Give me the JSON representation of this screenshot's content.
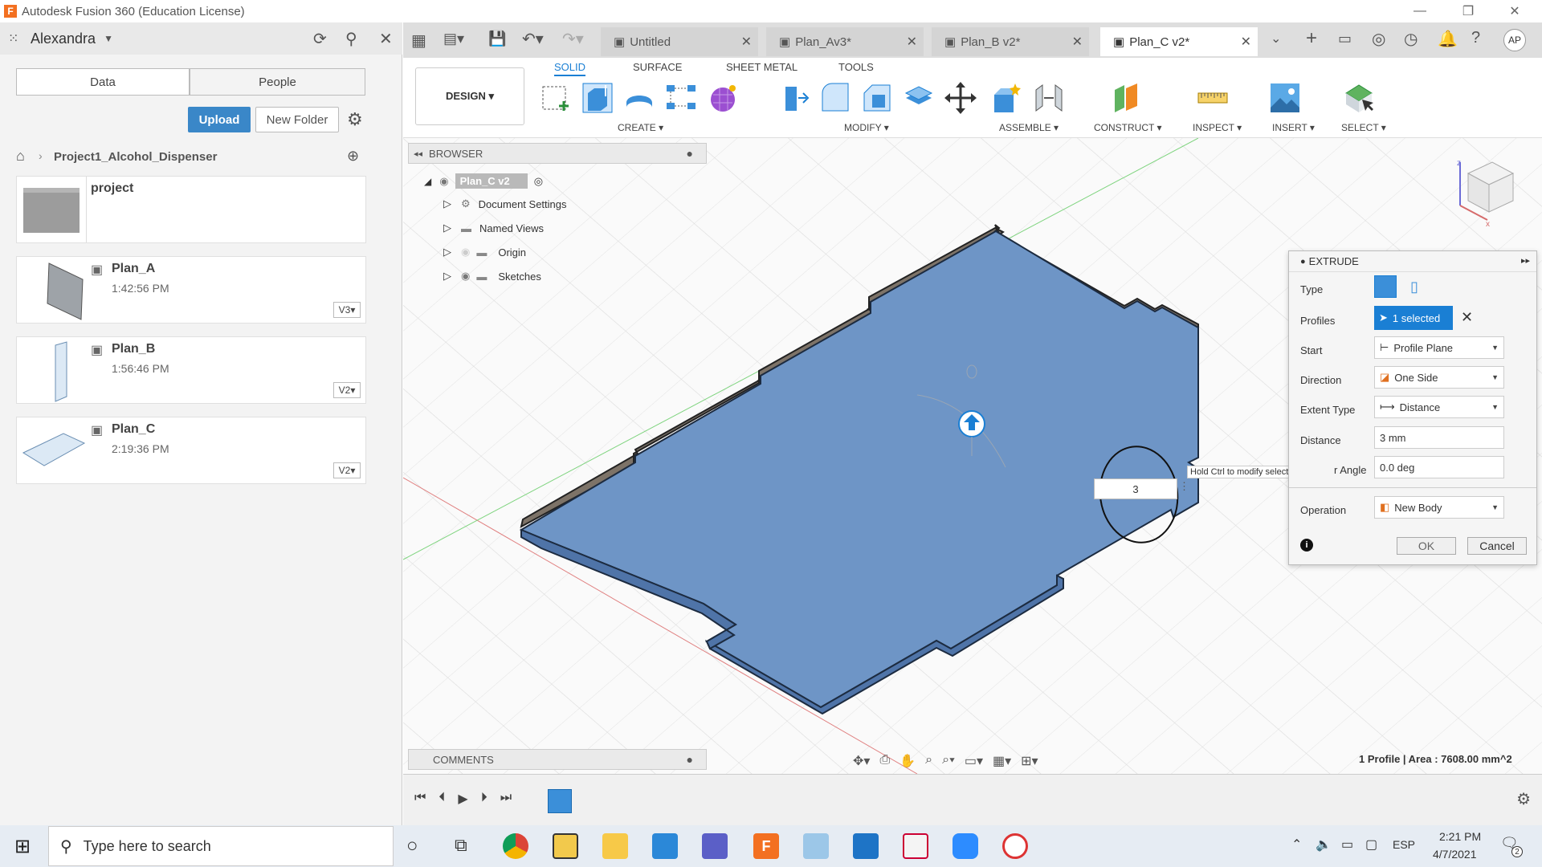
{
  "window": {
    "title": "Autodesk Fusion 360 (Education License)"
  },
  "data_panel": {
    "user": "Alexandra",
    "tabs": [
      "Data",
      "People"
    ],
    "upload_label": "Upload",
    "new_folder_label": "New Folder",
    "breadcrumb": "Project1_Alcohol_Dispenser",
    "folder": {
      "name": "project"
    },
    "files": [
      {
        "name": "Plan_A",
        "time": "1:42:56 PM",
        "version": "V3"
      },
      {
        "name": "Plan_B",
        "time": "1:56:46 PM",
        "version": "V2"
      },
      {
        "name": "Plan_C",
        "time": "2:19:36 PM",
        "version": "V2"
      }
    ]
  },
  "doc_tabs": [
    {
      "label": "Untitled"
    },
    {
      "label": "Plan_Av3*"
    },
    {
      "label": "Plan_B v2*"
    },
    {
      "label": "Plan_C v2*"
    }
  ],
  "user_initials": "AP",
  "toolbar": {
    "workspace": "DESIGN ▾",
    "tabs": [
      "SOLID",
      "SURFACE",
      "SHEET METAL",
      "TOOLS"
    ],
    "groups": [
      "CREATE ▾",
      "MODIFY ▾",
      "ASSEMBLE ▾",
      "CONSTRUCT ▾",
      "INSPECT ▾",
      "INSERT ▾",
      "SELECT ▾"
    ]
  },
  "browser": {
    "title": "BROWSER",
    "root": "Plan_C v2",
    "items": [
      "Document Settings",
      "Named Views",
      "Origin",
      "Sketches"
    ]
  },
  "extrude": {
    "title": "EXTRUDE",
    "rows": {
      "type_label": "Type",
      "profiles_label": "Profiles",
      "profiles_value": "1 selected",
      "start_label": "Start",
      "start_value": "Profile Plane",
      "direction_label": "Direction",
      "direction_value": "One Side",
      "extent_label": "Extent Type",
      "extent_value": "Distance",
      "distance_label": "Distance",
      "distance_value": "3 mm",
      "taper_label": "r Angle",
      "taper_value": "0.0 deg",
      "operation_label": "Operation",
      "operation_value": "New Body"
    },
    "ok_label": "OK",
    "cancel_label": "Cancel"
  },
  "canvas": {
    "tooltip": "Hold Ctrl to modify selection",
    "distance_input": "3",
    "status": "1 Profile | Area : 7608.00 mm^2"
  },
  "comments": {
    "title": "COMMENTS"
  },
  "taskbar": {
    "search_placeholder": "Type here to search",
    "lang": "ESP",
    "time": "2:21 PM",
    "date": "4/7/2021",
    "notif_count": "2"
  }
}
